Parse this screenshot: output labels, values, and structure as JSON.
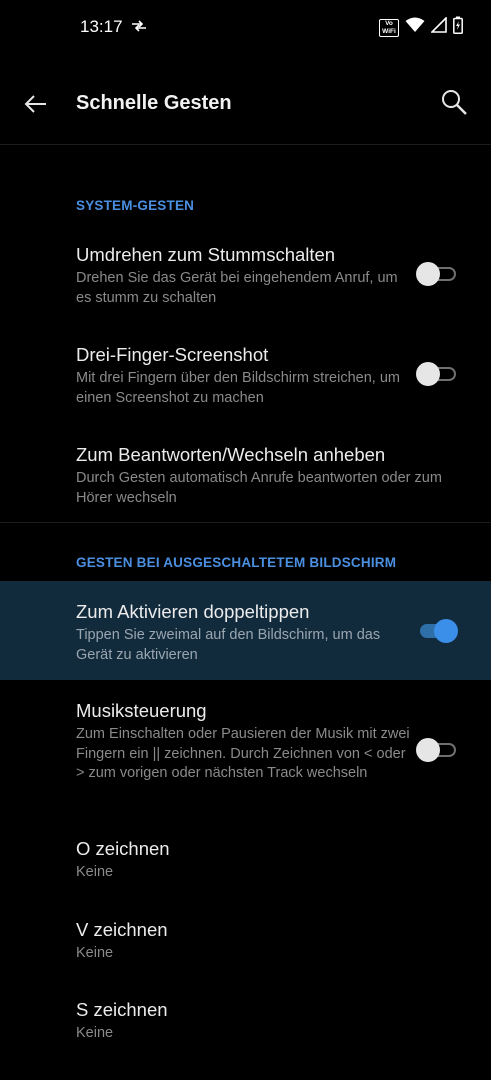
{
  "status_bar": {
    "time": "13:17",
    "icons": [
      "data-transfer-icon",
      "vowifi-icon",
      "wifi-icon",
      "signal-icon",
      "battery-charging-icon"
    ],
    "vowifi_label": "Vo WiFi"
  },
  "app_bar": {
    "title": "Schnelle Gesten",
    "back_icon": "back-arrow-icon",
    "search_icon": "search-icon"
  },
  "sections": [
    {
      "header": "SYSTEM-GESTEN",
      "items": [
        {
          "title": "Umdrehen zum Stummschalten",
          "summary": "Drehen Sie das Gerät bei eingehendem Anruf, um es stumm zu schalten",
          "toggle": false
        },
        {
          "title": "Drei-Finger-Screenshot",
          "summary": "Mit drei Fingern über den Bildschirm streichen, um einen Screenshot zu machen",
          "toggle": false
        },
        {
          "title": "Zum Beantworten/Wechseln anheben",
          "summary": "Durch Gesten automatisch Anrufe beantworten oder zum Hörer wechseln"
        }
      ]
    },
    {
      "header": "GESTEN BEI AUSGESCHALTETEM BILDSCHIRM",
      "items": [
        {
          "title": "Zum Aktivieren doppeltippen",
          "summary": "Tippen Sie zweimal auf den Bildschirm, um das Gerät zu aktivieren",
          "toggle": true,
          "highlighted": true
        },
        {
          "title": "Musiksteuerung",
          "summary": "Zum Einschalten oder Pausieren der Musik mit zwei Fingern ein || zeichnen. Durch Zeichnen von < oder > zum vorigen oder nächsten Track wechseln",
          "toggle": false
        },
        {
          "title": "O zeichnen",
          "summary": "Keine"
        },
        {
          "title": "V zeichnen",
          "summary": "Keine"
        },
        {
          "title": "S zeichnen",
          "summary": "Keine"
        }
      ]
    }
  ],
  "colors": {
    "background": "#000000",
    "accent": "#4a8fe0",
    "highlight_row": "#112a3c",
    "toggle_on": "#3b8fe8",
    "toggle_off_thumb": "#e6e6e6"
  }
}
